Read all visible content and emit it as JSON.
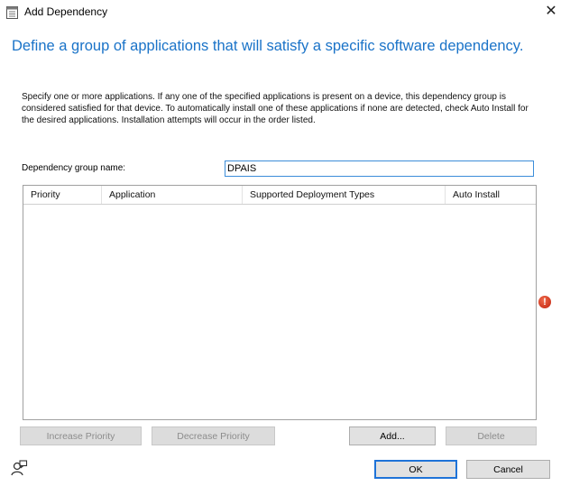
{
  "window": {
    "title": "Add Dependency"
  },
  "heading": "Define a group of applications that will satisfy a specific software dependency.",
  "description": "Specify one or more applications. If any one of the specified applications is present on a device, this dependency group is considered satisfied for that device. To automatically install one of these applications if none are detected, check Auto Install for the desired applications. Installation attempts will occur in the order listed.",
  "dependency_group": {
    "label": "Dependency group name:",
    "value": "DPAIS"
  },
  "list": {
    "columns": [
      "Priority",
      "Application",
      "Supported Deployment Types",
      "Auto Install"
    ],
    "rows": []
  },
  "buttons": {
    "increase_priority": "Increase Priority",
    "decrease_priority": "Decrease Priority",
    "add": "Add...",
    "delete": "Delete",
    "ok": "OK",
    "cancel": "Cancel"
  },
  "icons": {
    "titlebar": "dialog-window-icon",
    "close": "close-icon",
    "error": "error-icon",
    "feedback": "person-feedback-icon"
  },
  "colors": {
    "heading": "#1a73c8",
    "error": "#c0220f",
    "focus": "#1e73d8"
  }
}
